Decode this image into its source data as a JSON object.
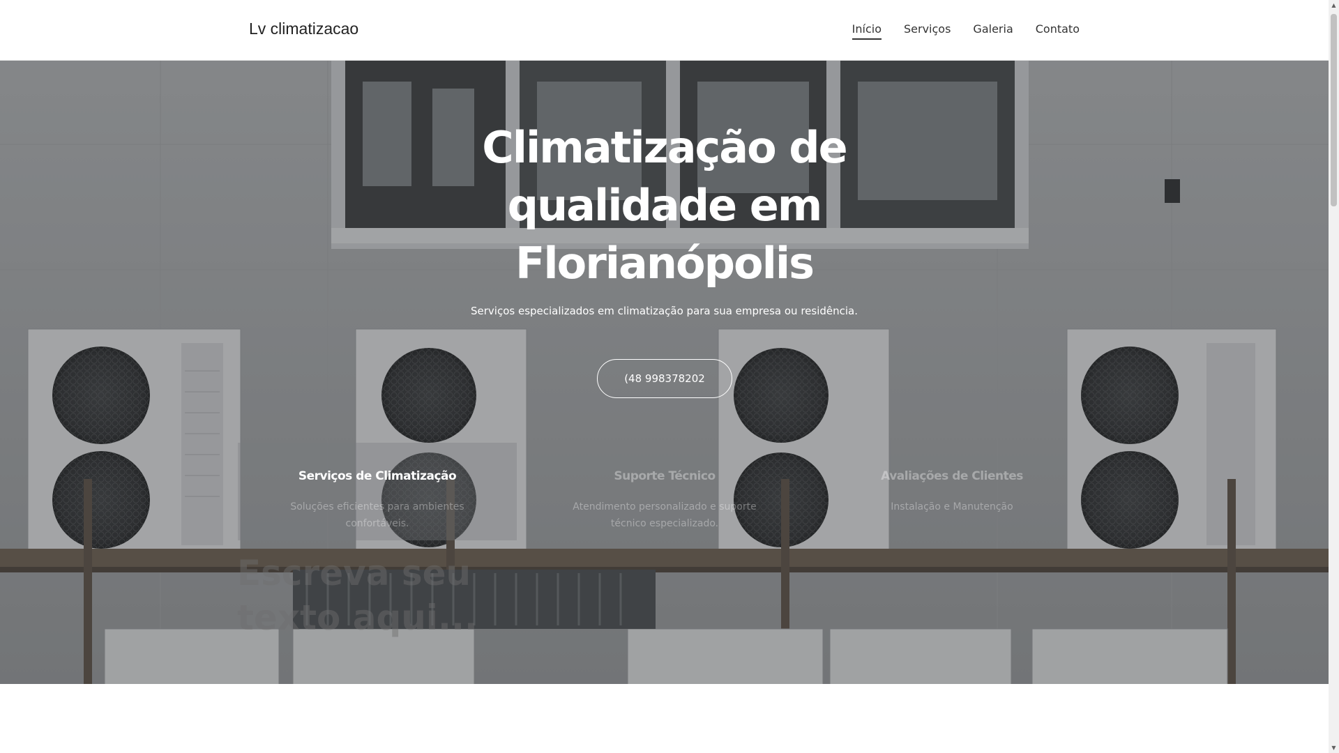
{
  "header": {
    "logo": "Lv climatizacao",
    "nav": [
      {
        "label": "Início",
        "active": true
      },
      {
        "label": "Serviços"
      },
      {
        "label": "Galeria"
      },
      {
        "label": "Contato"
      }
    ]
  },
  "hero": {
    "title": "Climatização de qualidade em Florianópolis",
    "subtitle": "Serviços especializados em climatização para sua empresa ou residência.",
    "phone_button": "(48 998378202",
    "features": [
      {
        "title": "Serviços de Climatização",
        "text": "Soluções eficientes para ambientes confortáveis."
      },
      {
        "title": "Suporte Técnico",
        "text": "Atendimento personalizado e suporte técnico especializado."
      },
      {
        "title": "Avaliações de Clientes",
        "text": "Instalação e Manutenção"
      }
    ],
    "ghost_text": "Escreva seu texto aqui..."
  },
  "colors": {
    "text_dark": "#222222",
    "hero_text": "#ffffff",
    "header_bg": "#ffffff"
  }
}
